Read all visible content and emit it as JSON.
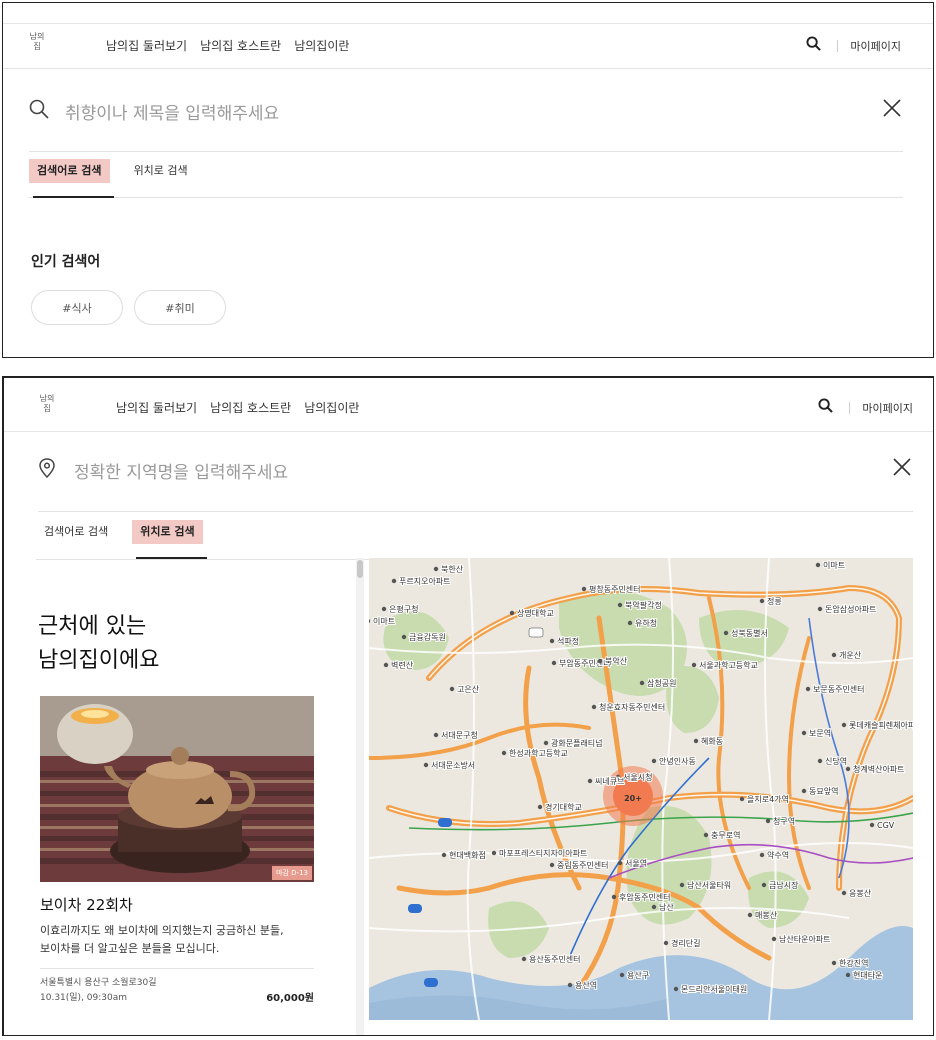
{
  "logo": {
    "line1": "남의",
    "line2": "집"
  },
  "nav": [
    "남의집 둘러보기",
    "남의집 호스트란",
    "남의집이란"
  ],
  "header": {
    "mypage": "마이페이지"
  },
  "keyword_view": {
    "search_placeholder": "취향이나 제목을 입력해주세요",
    "tabs": [
      "검색어로 검색",
      "위치로 검색"
    ],
    "active_tab": 0,
    "popular_title": "인기 검색어",
    "chips": [
      "#식사",
      "#취미"
    ]
  },
  "location_view": {
    "search_placeholder": "정확한 지역명을 입력해주세요",
    "tabs": [
      "검색어로 검색",
      "위치로 검색"
    ],
    "active_tab": 1,
    "nearby_title_1": "근처에 있는",
    "nearby_title_2": "남의집이에요",
    "item": {
      "badge": "마감 D-13",
      "title": "보이차 22회차",
      "desc_1": "이효리까지도 왜 보이차에 의지했는지 궁금하신 분들,",
      "desc_2": "보이차를 더 알고싶은 분들을 모십니다.",
      "address": "서울특별시 용산구 소월로30길",
      "datetime": "10.31(일), 09:30am",
      "price": "60,000원"
    },
    "map": {
      "cluster_label": "20+",
      "labels": [
        "북한산",
        "푸르지오아파트",
        "은평구청",
        "이마트",
        "금융감독원",
        "벽련산",
        "고은산",
        "서대문구청",
        "서대문소방서",
        "한성과학고등학교",
        "평창동주민센터",
        "북악팔각정",
        "상명대학교",
        "유하청",
        "석파정",
        "부암동주민센터",
        "북악산",
        "삼청공원",
        "청운효자동주민센터",
        "광화문플래티넘",
        "안녕인사동",
        "서울과학고등학교",
        "성북동별서",
        "혜화동",
        "서울시청",
        "씨네큐브",
        "경기대학교",
        "현대백화점",
        "마포프레스티지자이아파트",
        "중림동주민센터",
        "서울역",
        "후암동주민센터",
        "남산",
        "경리단길",
        "용산구",
        "용산동주민센터",
        "용산역",
        "몬드리안서울이태원",
        "남산서울타워",
        "청구역",
        "약수역",
        "금남시장",
        "보문동주민센터",
        "보문역",
        "신당역",
        "동묘앞역",
        "을지로4가역",
        "충무로역",
        "정릉",
        "돈암삼성아파트",
        "개운산",
        "롯데캐슬피렌체아파트",
        "청계벽산아파트",
        "CGV",
        "이마트",
        "매봉산",
        "남산타운아파트",
        "응봉산",
        "한강진역",
        "현대타운"
      ]
    }
  },
  "colors": {
    "accent": "#f3c9c6",
    "cluster": "#f27a50",
    "road": "#f3a04a"
  }
}
